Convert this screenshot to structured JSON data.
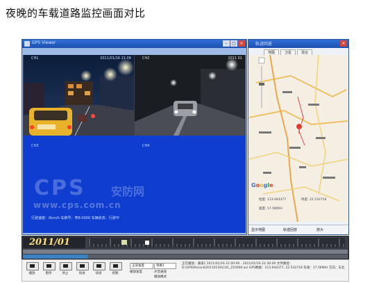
{
  "caption": "夜晚的车载道路监控画面对比",
  "video_window": {
    "title": "GPS Viewer",
    "cam1_timestamp": "2011/01/16 21:09",
    "cam2_timestamp": "2011 01",
    "cam_channel_labels": [
      "CH1",
      "CH2",
      "CH3",
      "CH4"
    ],
    "status_text": "行驶速度：0km/h   车牌号：粤B·0000   车辆状态：行驶中"
  },
  "watermark": {
    "brand": "CPS",
    "brand_cn": "安防网",
    "url": "www.cps.com.cn"
  },
  "map_window": {
    "title": "轨迹回放",
    "tabs": [
      "地图",
      "卫星",
      "混合"
    ],
    "google_logo": "Google",
    "coord_lon": "经度: 113.944377",
    "coord_lat": "纬度: 22.532718",
    "coord_speed": "速度: 17.5KM/H",
    "footer_items": [
      "显示地图",
      "轨迹回放",
      "放大"
    ]
  },
  "timeline": {
    "date": "2011/01"
  },
  "controls": {
    "buttons": [
      "播放",
      "暂停",
      "停止",
      "快进",
      "快退",
      "抓图"
    ],
    "speed_select": "正常速度",
    "speed_label": "播放速度",
    "channel_select": "单路1",
    "channel_label": "声音通道",
    "mode_label": "播放模式",
    "info_text": "正在播放：通道1 2011/01/16 21:00:00 - 2011/01/16 21:30:00 文件路径：D:\\GPS\\Record\\20110116\\CH1_210000.avi  GPS数据：113.944377, 22.532718  车速：17.5KM/H  方向：东北"
  }
}
